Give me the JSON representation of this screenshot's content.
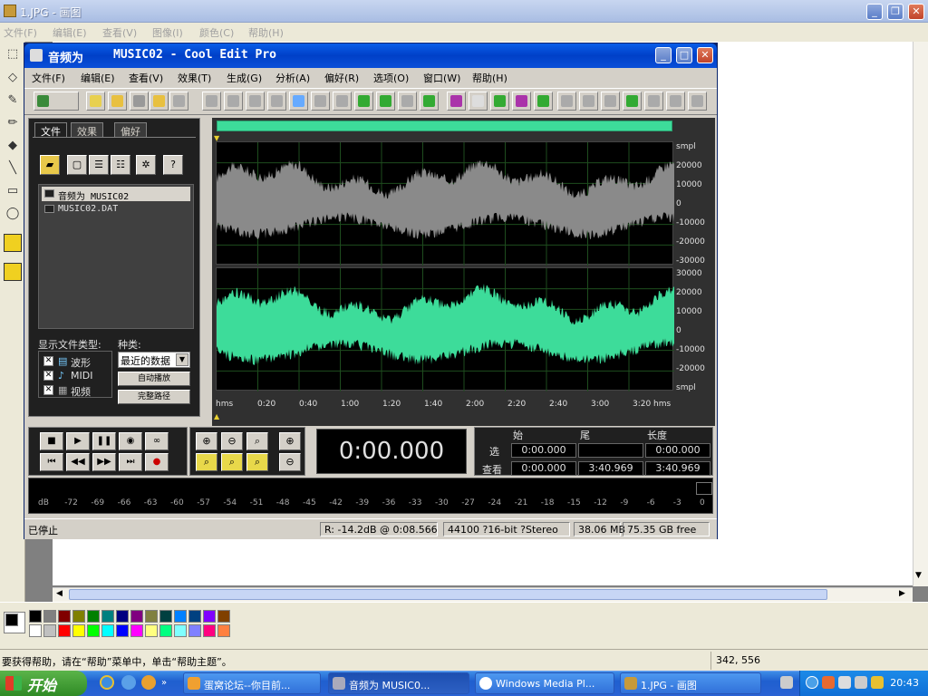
{
  "paint": {
    "title": "1.JPG - 画图",
    "menu": [
      "文件(F)",
      "编辑(E)",
      "查看(V)",
      "图像(I)",
      "颜色(C)",
      "帮助(H)"
    ],
    "status_msg": "要获得帮助，请在“帮助”菜单中，单击“帮助主题”。",
    "coords": "342, 556"
  },
  "coolEdit": {
    "title": "音频为",
    "title_file": "MUSIC02 - Cool Edit Pro",
    "menu": [
      "文件(F)",
      "编辑(E)",
      "查看(V)",
      "效果(T)",
      "生成(G)",
      "分析(A)",
      "偏好(R)",
      "选项(O)",
      "窗口(W)",
      "帮助(H)"
    ],
    "panel": {
      "tabs": [
        "文件",
        "效果",
        "偏好"
      ],
      "files": [
        {
          "label": "音频为     MUSIC02"
        },
        {
          "label": "MUSIC02.DAT"
        }
      ],
      "show_types_label": "显示文件类型:",
      "kind_label": "种类:",
      "types": [
        "波形",
        "MIDI",
        "视频"
      ],
      "kind_value": "最近的数据",
      "auto_play": "自动播放",
      "full_path": "完整路径"
    },
    "right_axis_top": [
      "smpl",
      "20000",
      "10000",
      "0",
      "-10000",
      "-20000",
      "-30000"
    ],
    "right_axis_bottom": [
      "30000",
      "20000",
      "10000",
      "0",
      "-10000",
      "-20000",
      "smpl"
    ],
    "time_ticks": [
      "hms",
      "0:20",
      "0:40",
      "1:00",
      "1:20",
      "1:40",
      "2:00",
      "2:20",
      "2:40",
      "3:00",
      "3:20",
      "hms"
    ],
    "time_display": "0:00.000",
    "sel_headers": [
      "始",
      "尾",
      "长度"
    ],
    "sel_row_label": "选",
    "view_row_label": "查看",
    "sel_values": [
      "0:00.000",
      "",
      "0:00.000"
    ],
    "view_values": [
      "0:00.000",
      "3:40.969",
      "3:40.969"
    ],
    "level_ticks": [
      "dB",
      "-72",
      "-69",
      "-66",
      "-63",
      "-60",
      "-57",
      "-54",
      "-51",
      "-48",
      "-45",
      "-42",
      "-39",
      "-36",
      "-33",
      "-30",
      "-27",
      "-24",
      "-21",
      "-18",
      "-15",
      "-12",
      "-9",
      "-6",
      "-3",
      "0"
    ],
    "status": {
      "state": "已停止",
      "level": "R: -14.2dB @  0:08.566",
      "format": "44100 ?16-bit ?Stereo",
      "size": "38.06 MB",
      "free": "75.35 GB free"
    }
  },
  "taskbar": {
    "start": "开始",
    "tasks": [
      "蛋窝论坛--你目前...",
      "音频为     MUSIC0...",
      "Windows Media Pl...",
      "1.JPG - 画图"
    ],
    "clock": "20:43"
  },
  "colors": {
    "wave_top": "#8a8a8a",
    "wave_bottom": "#3ddc9a",
    "xp_blue": "#0a4fd8"
  }
}
